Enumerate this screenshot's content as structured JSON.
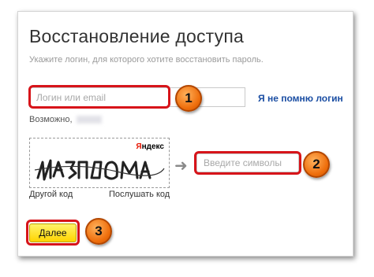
{
  "page": {
    "title": "Восстановление доступа",
    "subtitle": "Укажите логин, для которого хотите восстановить пароль."
  },
  "login": {
    "placeholder": "Логин или email",
    "forgot_link": "Я не помню логин",
    "maybe_text": "Возможно,"
  },
  "captcha": {
    "logo_first": "Я",
    "logo_rest": "ндекс",
    "other_code": "Другой код",
    "listen": "Послушать код",
    "input_placeholder": "Введите символы"
  },
  "submit": {
    "label": "Далее"
  },
  "annotations": {
    "badge1": "1",
    "badge2": "2",
    "badge3": "3"
  },
  "colors": {
    "highlight": "#d7141a",
    "badge": "#ee6d0b",
    "button": "#ffd400",
    "link": "#1b4ea3"
  }
}
